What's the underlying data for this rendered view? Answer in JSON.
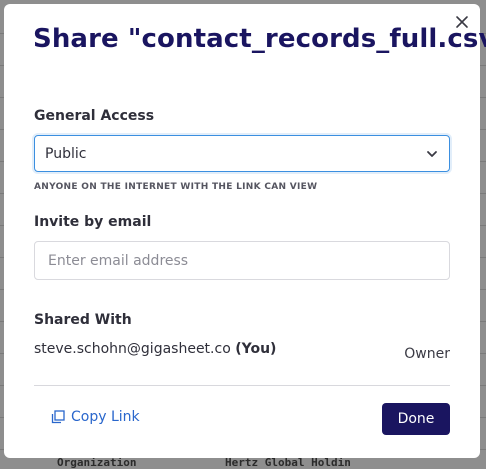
{
  "background": {
    "cells": [
      "Organization",
      "Hertz Global Holdin"
    ]
  },
  "dialog": {
    "title": "Share \"contact_records_full.csv\"",
    "general_access": {
      "label": "General Access",
      "selected": "Public",
      "hint": "ANYONE ON THE INTERNET WITH THE LINK CAN VIEW"
    },
    "invite": {
      "label": "Invite by email",
      "placeholder": "Enter email address",
      "value": ""
    },
    "shared_with": {
      "label": "Shared With",
      "users": [
        {
          "email": "steve.schohn@gigasheet.co",
          "you_tag": "(You)",
          "role": "Owner"
        }
      ]
    },
    "copy_link_label": "Copy Link",
    "done_label": "Done"
  },
  "colors": {
    "accent": "#1a1560",
    "link": "#2966cc",
    "focus_border": "#3b8fe0"
  },
  "icons": {
    "close": "close-icon",
    "dropdown": "chevron-down-icon",
    "copy": "copy-icon"
  }
}
